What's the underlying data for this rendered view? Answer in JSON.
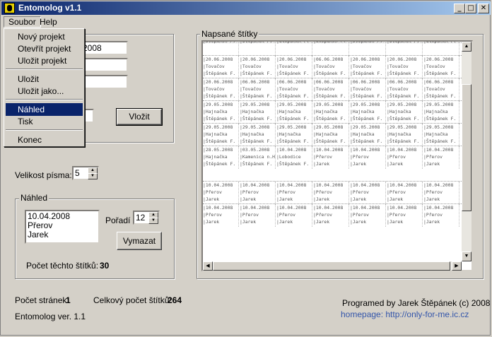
{
  "window": {
    "title": "Entomolog v1.1",
    "min": "_",
    "max": "□",
    "close": "✕"
  },
  "menu": {
    "file": "Soubor",
    "help": "Help"
  },
  "dropdown": {
    "items": [
      "Nový projekt",
      "Otevřít projekt",
      "Uložit projekt",
      "Uložit",
      "Uložit jako...",
      "Náhled",
      "Tisk",
      "Konec"
    ]
  },
  "form": {
    "date_value": "2008",
    "insert_button": "Vložit"
  },
  "font": {
    "label": "Velikost písma:",
    "value": "5"
  },
  "preview": {
    "group_label": "Náhled",
    "lines": [
      "10.04.2008",
      "Přerov",
      "Jarek"
    ],
    "order_label": "Pořadí",
    "order_value": "12",
    "delete_button": "Vymazat",
    "count_label": "Počet těchto štítků:",
    "count_value": "30"
  },
  "labels_panel": {
    "title": "Napsané štítky",
    "rows": [
      {
        "cols": [
          [
            "|Štěpánek F.",
            "",
            "",
            ""
          ],
          [
            "|Štěpánek F.",
            "",
            "",
            ""
          ],
          [
            "|Štěpánek F.",
            "",
            "",
            ""
          ],
          [
            "|Štěpánek F.",
            "",
            "",
            ""
          ],
          [
            "|Štěpánek F.",
            "",
            "",
            ""
          ],
          [
            "|Štěpánek F.",
            "",
            "",
            ""
          ],
          [
            "|Štěpánek F.",
            "",
            "",
            ""
          ]
        ]
      },
      {
        "cols": [
          [
            "|20.06.2008",
            "|Tovačov",
            "|Štěpánek F.",
            ""
          ],
          [
            "|20.06.2008",
            "|Tovačov",
            "|Štěpánek F.",
            ""
          ],
          [
            "|20.06.2008",
            "|Tovačov",
            "|Štěpánek F.",
            ""
          ],
          [
            "|06.06.2008",
            "|Tovačov",
            "|Štěpánek F.",
            ""
          ],
          [
            "|20.06.2008",
            "|Tovačov",
            "|Štěpánek F.",
            ""
          ],
          [
            "|20.06.2008",
            "|Tovačov",
            "|Štěpánek F.",
            ""
          ],
          [
            "|20.06.2008",
            "|Tovačov",
            "|Štěpánek F.",
            ""
          ]
        ]
      },
      {
        "cols": [
          [
            "|20.06.2008",
            "|Tovačov",
            "|Štěpánek F.",
            ""
          ],
          [
            "|06.06.2008",
            "|Tovačov",
            "|Štěpánek F.",
            ""
          ],
          [
            "|06.06.2008",
            "|Tovačov",
            "|Štěpánek F.",
            ""
          ],
          [
            "|06.06.2008",
            "|Tovačov",
            "|Štěpánek F.",
            ""
          ],
          [
            "|06.06.2008",
            "|Tovačov",
            "|Štěpánek F.",
            ""
          ],
          [
            "|06.06.2008",
            "|Tovačov",
            "|Štěpánek F.",
            ""
          ],
          [
            "|06.06.2008",
            "|Tovačov",
            "|Štěpánek F.",
            ""
          ]
        ]
      },
      {
        "cols": [
          [
            "|29.05.2008",
            "|Hajnačka",
            "|Štěpánek F.",
            ""
          ],
          [
            "|29.05.2008",
            "|Hajnačka",
            "|Štěpánek F.",
            ""
          ],
          [
            "|29.05.2008",
            "|Hajnačka",
            "|Štěpánek F.",
            ""
          ],
          [
            "|29.05.2008",
            "|Hajnačka",
            "|Štěpánek F.",
            ""
          ],
          [
            "|29.05.2008",
            "|Hajnačka",
            "|Štěpánek F.",
            ""
          ],
          [
            "|29.05.2008",
            "|Hajnačka",
            "|Štěpánek F.",
            ""
          ],
          [
            "|29.05.2008",
            "|Hajnačka",
            "|Štěpánek F.",
            ""
          ]
        ]
      },
      {
        "cols": [
          [
            "|29.05.2008",
            "|Hajnačka",
            "|Štěpánek F.",
            ""
          ],
          [
            "|29.05.2008",
            "|Hajnačka",
            "|Štěpánek F.",
            ""
          ],
          [
            "|29.05.2008",
            "|Hajnačka",
            "|Štěpánek F.",
            ""
          ],
          [
            "|29.05.2008",
            "|Hajnačka",
            "|Štěpánek F.",
            ""
          ],
          [
            "|29.05.2008",
            "|Hajnačka",
            "|Štěpánek F.",
            ""
          ],
          [
            "|29.05.2008",
            "|Hajnačka",
            "|Štěpánek F.",
            ""
          ],
          [
            "|29.05.2008",
            "|Hajnačka",
            "|Štěpánek F.",
            ""
          ]
        ]
      },
      {
        "cols": [
          [
            "|28.05.2008",
            "|Hajnačka",
            "|Štěpánek F.",
            ""
          ],
          [
            "|03.05.2008",
            "|Kamenica n.H",
            "|Štěpánek F.",
            ""
          ],
          [
            "|10.04.2008",
            "|Lobodice",
            "|Štěpánek F.",
            ""
          ],
          [
            "|10.04.2008",
            "|Přerov",
            "|Jarek",
            ""
          ],
          [
            "|10.04.2008",
            "|Přerov",
            "|Jarek",
            ""
          ],
          [
            "|10.04.2008",
            "|Přerov",
            "|Jarek",
            ""
          ],
          [
            "|10.04.2008",
            "|Přerov",
            "|Jarek",
            ""
          ]
        ]
      },
      {
        "cols": [
          [
            "|10.04.2008",
            "|Přerov",
            "|Jarek",
            ""
          ],
          [
            "|10.04.2008",
            "|Přerov",
            "|Jarek",
            ""
          ],
          [
            "|10.04.2008",
            "|Přerov",
            "|Jarek",
            ""
          ],
          [
            "|10.04.2008",
            "|Přerov",
            "|Jarek",
            ""
          ],
          [
            "|10.04.2008",
            "|Přerov",
            "|Jarek",
            ""
          ],
          [
            "|10.04.2008",
            "|Přerov",
            "|Jarek",
            ""
          ],
          [
            "|10.04.2008",
            "|Přerov",
            "|Jarek",
            ""
          ]
        ]
      },
      {
        "cols": [
          [
            "|10.04.2008",
            "|Přerov",
            "|Jarek",
            ""
          ],
          [
            "|10.04.2008",
            "|Přerov",
            "|Jarek",
            ""
          ],
          [
            "|10.04.2008",
            "|Přerov",
            "|Jarek",
            ""
          ],
          [
            "|10.04.2008",
            "|Přerov",
            "|Jarek",
            ""
          ],
          [
            "|10.04.2008",
            "|Přerov",
            "|Jarek",
            ""
          ],
          [
            "|10.04.2008",
            "|Přerov",
            "|Jarek",
            ""
          ],
          [
            "|10.04.2008",
            "|Přerov",
            "|Jarek",
            ""
          ]
        ]
      }
    ]
  },
  "stats": {
    "pages_label": "Počet stránek:",
    "pages_value": "1",
    "total_label": "Celkový počet štítků:",
    "total_value": "264",
    "version": "Entomolog ver. 1.1",
    "credits": "Programed by Jarek Štěpánek (c) 2008",
    "homepage": "homepage: http://only-for-me.ic.cz"
  },
  "colors": {
    "homepage": "#3355aa",
    "selection": "#0a246a"
  }
}
